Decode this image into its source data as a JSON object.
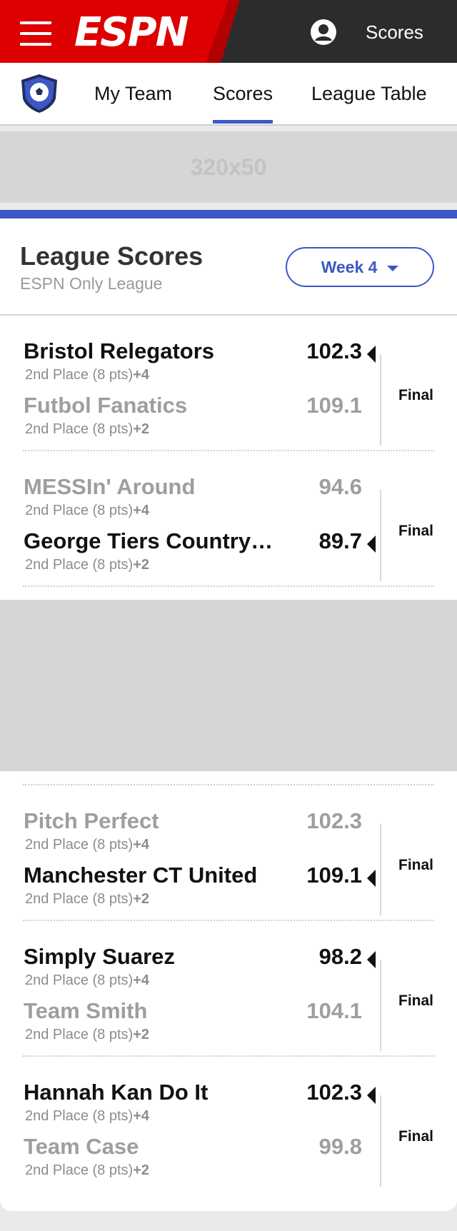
{
  "header": {
    "brand": "ESPN",
    "right_label": "Scores"
  },
  "nav": {
    "tabs": [
      {
        "label": "My Team"
      },
      {
        "label": "Scores",
        "active": true
      },
      {
        "label": "League Table"
      }
    ]
  },
  "ad_banner": {
    "size_label": "320x50"
  },
  "league": {
    "title": "League Scores",
    "subtitle": "ESPN Only League",
    "week_label": "Week 4"
  },
  "colors": {
    "accent": "#3d58c6",
    "brand_red": "#dd0000"
  },
  "matchups": [
    {
      "status": "Final",
      "teams": [
        {
          "name": "Bristol Relegators",
          "meta": "2nd Place (8 pts)",
          "delta": "+4",
          "score": "102.3",
          "winner": true
        },
        {
          "name": "Futbol Fanatics",
          "meta": "2nd Place (8 pts)",
          "delta": "+2",
          "score": "109.1",
          "winner": false
        }
      ]
    },
    {
      "status": "Final",
      "teams": [
        {
          "name": "MESSIn' Around",
          "meta": "2nd Place (8 pts)",
          "delta": "+4",
          "score": "94.6",
          "winner": false
        },
        {
          "name": "George Tiers Country…",
          "meta": "2nd Place (8 pts)",
          "delta": "+2",
          "score": "89.7",
          "winner": true
        }
      ]
    },
    {
      "status": "Final",
      "teams": [
        {
          "name": "Pitch Perfect",
          "meta": "2nd Place (8 pts)",
          "delta": "+4",
          "score": "102.3",
          "winner": false
        },
        {
          "name": "Manchester CT United",
          "meta": "2nd Place (8 pts)",
          "delta": "+2",
          "score": "109.1",
          "winner": true
        }
      ]
    },
    {
      "status": "Final",
      "teams": [
        {
          "name": "Simply Suarez",
          "meta": "2nd Place (8 pts)",
          "delta": "+4",
          "score": "98.2",
          "winner": true
        },
        {
          "name": "Team Smith",
          "meta": "2nd Place (8 pts)",
          "delta": "+2",
          "score": "104.1",
          "winner": false
        }
      ]
    },
    {
      "status": "Final",
      "teams": [
        {
          "name": "Hannah Kan Do It",
          "meta": "2nd Place (8 pts)",
          "delta": "+4",
          "score": "102.3",
          "winner": true
        },
        {
          "name": "Team Case",
          "meta": "2nd Place (8 pts)",
          "delta": "+2",
          "score": "99.8",
          "winner": false
        }
      ]
    }
  ]
}
